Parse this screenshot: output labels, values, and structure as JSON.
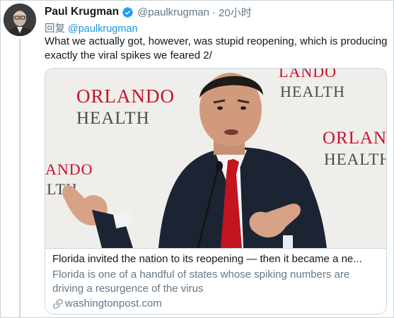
{
  "author": {
    "display_name": "Paul Krugman",
    "handle": "@paulkrugman",
    "separator": "·",
    "time": "20小时",
    "verified": true
  },
  "reply": {
    "label": "回复",
    "to": "@paulkrugman"
  },
  "tweet": {
    "text": "What we actually got, however, was stupid reopening, which is producing exactly the viral spikes we feared 2/"
  },
  "card": {
    "image_signs": {
      "left_line1": "ORLANDO",
      "left_line2": "HEALTH",
      "top_right_line1": "LANDO",
      "top_right_line2": "HEALTH",
      "right_line1": "ORLAN",
      "right_line2": "HEALTH",
      "far_left_line1": "ANDO",
      "far_left_line2": "LTH"
    },
    "title": "Florida invited the nation to its reopening — then it became a ne...",
    "description": "Florida is one of a handful of states whose spiking numbers are driving a resurgence of the virus",
    "domain": "washingtonpost.com"
  },
  "icons": {
    "verified": "verified-badge-icon",
    "link": "link-icon"
  },
  "colors": {
    "link_blue": "#1b95e0",
    "muted_grey": "#657786",
    "verified_blue": "#1da1f2",
    "brand_red": "#c8102e"
  }
}
